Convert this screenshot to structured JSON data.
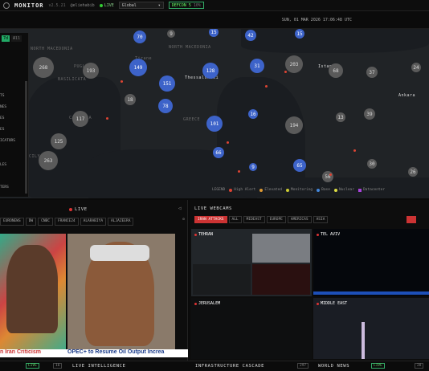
{
  "topbar": {
    "brand": "MONITOR",
    "version": "v2.5.21",
    "user": "@eliehabib",
    "live_label": "LIVE",
    "region": "Global",
    "defcon_label": "DEFCON 5",
    "defcon_value": "10%"
  },
  "datetime": "SUN, 01 MAR 2026 17:06:48 UTC",
  "side": {
    "tab_a": "7d",
    "tab_b": "All",
    "items": [
      "TS",
      "NES",
      "ES",
      "ES",
      "ICATORS",
      "LES",
      "TERS"
    ]
  },
  "map_labels": {
    "north_macedonia": "NORTH MACEDONIA",
    "puglia": "PUGLIA",
    "basilicata": "BASILICATA",
    "tirane": "Tirane",
    "thessaloniki": "Thessaloniki",
    "greece": "GREECE",
    "calabria": "CALABRIA",
    "sicily": "CILY",
    "istanbul": "Istanbul",
    "ankara": "Ankara"
  },
  "clusters": [
    {
      "v": "70",
      "c": "blue"
    },
    {
      "v": "9",
      "c": "grey"
    },
    {
      "v": "15",
      "c": "blue"
    },
    {
      "v": "42",
      "c": "blue"
    },
    {
      "v": "15",
      "c": "blue"
    },
    {
      "v": "37",
      "c": "grey"
    },
    {
      "v": "268",
      "c": "grey"
    },
    {
      "v": "193",
      "c": "grey"
    },
    {
      "v": "149",
      "c": "blue"
    },
    {
      "v": "128",
      "c": "blue"
    },
    {
      "v": "31",
      "c": "blue"
    },
    {
      "v": "203",
      "c": "grey"
    },
    {
      "v": "68",
      "c": "grey"
    },
    {
      "v": "37",
      "c": "grey"
    },
    {
      "v": "24",
      "c": "grey"
    },
    {
      "v": "151",
      "c": "blue"
    },
    {
      "v": "18",
      "c": "grey"
    },
    {
      "v": "78",
      "c": "blue"
    },
    {
      "v": "16",
      "c": "blue"
    },
    {
      "v": "39",
      "c": "grey"
    },
    {
      "v": "117",
      "c": "grey"
    },
    {
      "v": "101",
      "c": "blue"
    },
    {
      "v": "194",
      "c": "grey"
    },
    {
      "v": "13",
      "c": "grey"
    },
    {
      "v": "125",
      "c": "grey"
    },
    {
      "v": "263",
      "c": "grey"
    },
    {
      "v": "66",
      "c": "blue"
    },
    {
      "v": "9",
      "c": "blue"
    },
    {
      "v": "65",
      "c": "blue"
    },
    {
      "v": "30",
      "c": "grey"
    },
    {
      "v": "26",
      "c": "grey"
    },
    {
      "v": "56",
      "c": "grey"
    }
  ],
  "legend": {
    "title": "LEGEND",
    "items": [
      {
        "label": "High Alert",
        "color": "#d43"
      },
      {
        "label": "Elevated",
        "color": "#d93"
      },
      {
        "label": "Monitoring",
        "color": "#cc3"
      },
      {
        "label": "Base",
        "color": "#48d"
      },
      {
        "label": "Nuclear",
        "color": "#dd4"
      },
      {
        "label": "Datacenter",
        "color": "#a4d"
      }
    ]
  },
  "news": {
    "live": "LIVE",
    "channels": [
      "EURONEWS",
      "DW",
      "CNBC",
      "FRANCE24",
      "ALARABIYA",
      "ALJAZEERA"
    ],
    "ticker_a": "n Iran Criticism",
    "ticker_b": "OPEC+ to Resume Oil Output Increa"
  },
  "webcams": {
    "title": "LIVE WEBCAMS",
    "tabs": [
      "IRAN ATTACKS",
      "ALL",
      "MIDEAST",
      "EUROPE",
      "AMERICAS",
      "ASIA"
    ],
    "cams": [
      "TEHRAN",
      "TEL AVIV",
      "JERUSALEM",
      "MIDDLE EAST"
    ]
  },
  "bottom": {
    "live": "LIVE",
    "count_a": "16",
    "intel": "LIVE INTELLIGENCE",
    "cascade": "INFRASTRUCTURE CASCADE",
    "cascade_badge": "297",
    "world": "WORLD NEWS",
    "world_live": "LIVE",
    "count_b": "28"
  }
}
